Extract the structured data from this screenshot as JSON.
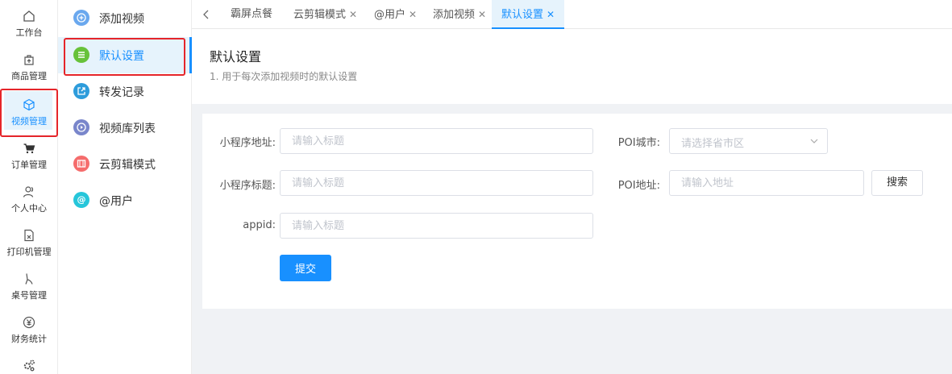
{
  "rail": {
    "items": [
      {
        "label": "工作台",
        "icon": "home-icon"
      },
      {
        "label": "商品管理",
        "icon": "product-icon"
      },
      {
        "label": "视频管理",
        "icon": "cube-icon"
      },
      {
        "label": "订单管理",
        "icon": "cart-icon"
      },
      {
        "label": "个人中心",
        "icon": "user-icon"
      },
      {
        "label": "打印机管理",
        "icon": "printer-icon"
      },
      {
        "label": "桌号管理",
        "icon": "table-number-icon"
      },
      {
        "label": "财务统计",
        "icon": "yuan-icon"
      },
      {
        "label": "",
        "icon": "gears-icon"
      }
    ],
    "active_index": 2
  },
  "submenu": {
    "items": [
      {
        "label": "添加视频",
        "icon": "plus-circle-icon",
        "color": "#6aa8ee"
      },
      {
        "label": "默认设置",
        "icon": "list-icon",
        "color": "#67c23a"
      },
      {
        "label": "转发记录",
        "icon": "share-icon",
        "color": "#2d9cdb"
      },
      {
        "label": "视频库列表",
        "icon": "play-circle-icon",
        "color": "#7986cb"
      },
      {
        "label": "云剪辑模式",
        "icon": "film-icon",
        "color": "#f56c6c"
      },
      {
        "label": "@用户",
        "icon": "at-icon",
        "color": "#26c6da"
      }
    ],
    "active_index": 1
  },
  "tabs": {
    "items": [
      {
        "label": "霸屏点餐",
        "closable": false
      },
      {
        "label": "云剪辑模式",
        "closable": true
      },
      {
        "label": "@用户",
        "closable": true
      },
      {
        "label": "添加视频",
        "closable": true
      },
      {
        "label": "默认设置",
        "closable": true
      }
    ],
    "active_index": 4
  },
  "page": {
    "title": "默认设置",
    "desc": "1. 用于每次添加视频时的默认设置"
  },
  "form": {
    "miniapp_url_label": "小程序地址:",
    "miniapp_url_placeholder": "请输入标题",
    "miniapp_title_label": "小程序标题:",
    "miniapp_title_placeholder": "请输入标题",
    "appid_label": "appid:",
    "appid_placeholder": "请输入标题",
    "poi_city_label": "POI城市:",
    "poi_city_placeholder": "请选择省市区",
    "poi_address_label": "POI地址:",
    "poi_address_placeholder": "请输入地址",
    "search_label": "搜索",
    "submit_label": "提交"
  },
  "colors": {
    "accent": "#1890ff",
    "highlight_box": "#e5252a",
    "active_bg": "#e6f3fc"
  }
}
